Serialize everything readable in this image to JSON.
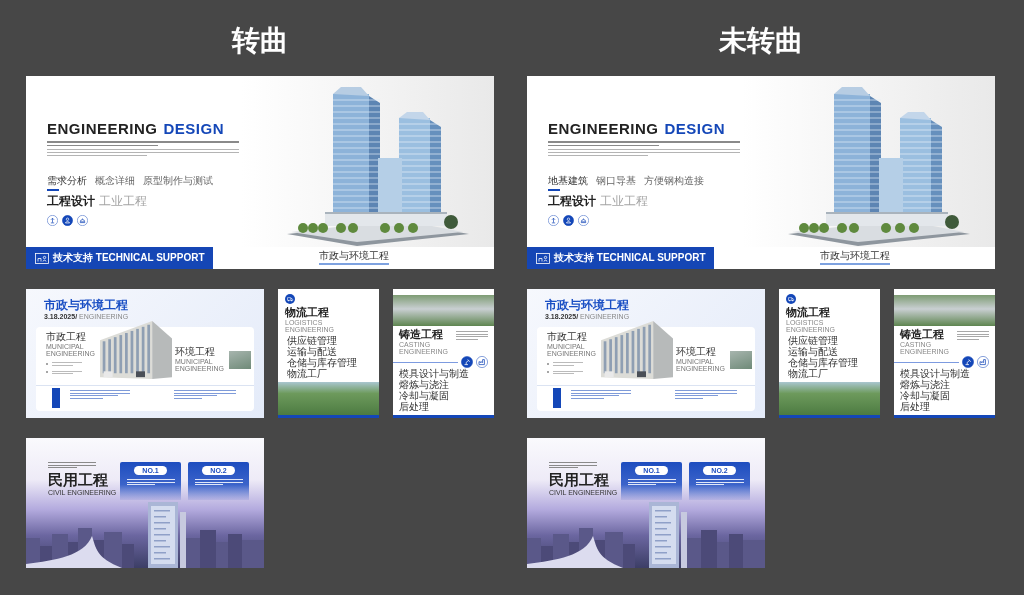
{
  "versions": [
    {
      "heading": "转曲",
      "hero": {
        "title": "ENGINEERING",
        "title_accent": "DESIGN",
        "tabs": [
          {
            "label": "需求分析",
            "selected": true
          },
          {
            "label": "概念详细",
            "selected": false
          },
          {
            "label": "原型制作与测试",
            "selected": false
          }
        ],
        "titles": [
          {
            "label": "工程设计",
            "selected": true
          },
          {
            "label": "工业工程",
            "selected": false
          }
        ],
        "icon_buttons": [
          {
            "selected": false
          },
          {
            "selected": true
          },
          {
            "selected": false
          }
        ],
        "support_label": "技术支持 TECHNICAL SUPPORT",
        "footer_tab": "市政与环境工程"
      },
      "municipal": {
        "title": "市政与环境工程",
        "date": "3.18.2025/",
        "date_label": "ENGINEERING",
        "sections": [
          {
            "title": "市政工程",
            "subtitle": "MUNICIPAL ENGINEERING"
          },
          {
            "title": "环境工程",
            "subtitle": "MUNICIPAL ENGINEERING"
          }
        ]
      },
      "logistics": {
        "title": "物流工程",
        "subtitle": "LOGISTICS ENGINEERING",
        "items": [
          "供应链管理",
          "运输与配送",
          "仓储与库存管理",
          "物流工厂"
        ]
      },
      "casting": {
        "title": "铸造工程",
        "subtitle": "CASTING ENGINEERING",
        "icons": [
          {
            "selected": true
          },
          {
            "selected": false
          }
        ],
        "items": [
          "模具设计与制造",
          "熔炼与浇注",
          "冷却与凝固",
          "后处理"
        ]
      },
      "civil": {
        "title": "民用工程",
        "subtitle": "CIVIL ENGINEERING",
        "cards": [
          {
            "label": "NO.1"
          },
          {
            "label": "NO.2"
          }
        ]
      }
    },
    {
      "heading": "未转曲",
      "hero": {
        "title": "ENGINEERING",
        "title_accent": "DESIGN",
        "tabs": [
          {
            "label": "地基建筑",
            "selected": true
          },
          {
            "label": "钢口导基",
            "selected": false
          },
          {
            "label": "方便钢构造接",
            "selected": false
          }
        ],
        "titles": [
          {
            "label": "工程设计",
            "selected": true
          },
          {
            "label": "工业工程",
            "selected": false
          }
        ],
        "icon_buttons": [
          {
            "selected": false
          },
          {
            "selected": true
          },
          {
            "selected": false
          }
        ],
        "support_label": "技术支持 TECHNICAL SUPPORT",
        "footer_tab": "市政与环境工程"
      },
      "municipal": {
        "title": "市政与环境工程",
        "date": "3.18.2025/",
        "date_label": "ENGINEERING",
        "sections": [
          {
            "title": "市政工程",
            "subtitle": "MUNICIPAL ENGINEERING"
          },
          {
            "title": "环境工程",
            "subtitle": "MUNICIPAL ENGINEERING"
          }
        ]
      },
      "logistics": {
        "title": "物流工程",
        "subtitle": "LOGISTICS ENGINEERING",
        "items": [
          "供应链管理",
          "运输与配送",
          "仓储与库存管理",
          "物流工厂"
        ]
      },
      "casting": {
        "title": "铸造工程",
        "subtitle": "CASTING ENGINEERING",
        "icons": [
          {
            "selected": true
          },
          {
            "selected": false
          }
        ],
        "items": [
          "模具设计与制造",
          "熔炼与浇注",
          "冷却与凝固",
          "后处理"
        ]
      },
      "civil": {
        "title": "民用工程",
        "subtitle": "CIVIL ENGINEERING",
        "cards": [
          {
            "label": "NO.1"
          },
          {
            "label": "NO.2"
          }
        ]
      }
    }
  ]
}
